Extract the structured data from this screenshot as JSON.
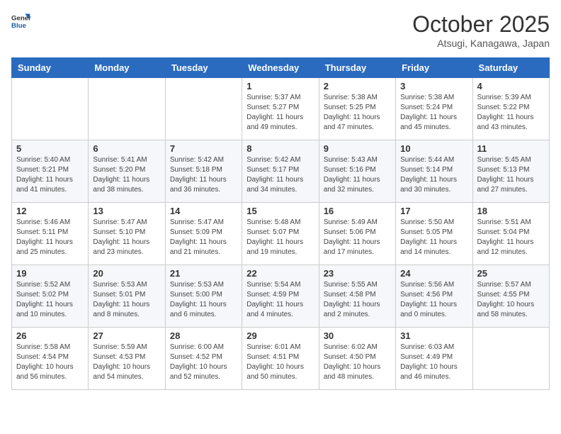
{
  "header": {
    "logo_line1": "General",
    "logo_line2": "Blue",
    "month": "October 2025",
    "location": "Atsugi, Kanagawa, Japan"
  },
  "weekdays": [
    "Sunday",
    "Monday",
    "Tuesday",
    "Wednesday",
    "Thursday",
    "Friday",
    "Saturday"
  ],
  "weeks": [
    [
      {
        "day": "",
        "info": ""
      },
      {
        "day": "",
        "info": ""
      },
      {
        "day": "",
        "info": ""
      },
      {
        "day": "1",
        "info": "Sunrise: 5:37 AM\nSunset: 5:27 PM\nDaylight: 11 hours\nand 49 minutes."
      },
      {
        "day": "2",
        "info": "Sunrise: 5:38 AM\nSunset: 5:25 PM\nDaylight: 11 hours\nand 47 minutes."
      },
      {
        "day": "3",
        "info": "Sunrise: 5:38 AM\nSunset: 5:24 PM\nDaylight: 11 hours\nand 45 minutes."
      },
      {
        "day": "4",
        "info": "Sunrise: 5:39 AM\nSunset: 5:22 PM\nDaylight: 11 hours\nand 43 minutes."
      }
    ],
    [
      {
        "day": "5",
        "info": "Sunrise: 5:40 AM\nSunset: 5:21 PM\nDaylight: 11 hours\nand 41 minutes."
      },
      {
        "day": "6",
        "info": "Sunrise: 5:41 AM\nSunset: 5:20 PM\nDaylight: 11 hours\nand 38 minutes."
      },
      {
        "day": "7",
        "info": "Sunrise: 5:42 AM\nSunset: 5:18 PM\nDaylight: 11 hours\nand 36 minutes."
      },
      {
        "day": "8",
        "info": "Sunrise: 5:42 AM\nSunset: 5:17 PM\nDaylight: 11 hours\nand 34 minutes."
      },
      {
        "day": "9",
        "info": "Sunrise: 5:43 AM\nSunset: 5:16 PM\nDaylight: 11 hours\nand 32 minutes."
      },
      {
        "day": "10",
        "info": "Sunrise: 5:44 AM\nSunset: 5:14 PM\nDaylight: 11 hours\nand 30 minutes."
      },
      {
        "day": "11",
        "info": "Sunrise: 5:45 AM\nSunset: 5:13 PM\nDaylight: 11 hours\nand 27 minutes."
      }
    ],
    [
      {
        "day": "12",
        "info": "Sunrise: 5:46 AM\nSunset: 5:11 PM\nDaylight: 11 hours\nand 25 minutes."
      },
      {
        "day": "13",
        "info": "Sunrise: 5:47 AM\nSunset: 5:10 PM\nDaylight: 11 hours\nand 23 minutes."
      },
      {
        "day": "14",
        "info": "Sunrise: 5:47 AM\nSunset: 5:09 PM\nDaylight: 11 hours\nand 21 minutes."
      },
      {
        "day": "15",
        "info": "Sunrise: 5:48 AM\nSunset: 5:07 PM\nDaylight: 11 hours\nand 19 minutes."
      },
      {
        "day": "16",
        "info": "Sunrise: 5:49 AM\nSunset: 5:06 PM\nDaylight: 11 hours\nand 17 minutes."
      },
      {
        "day": "17",
        "info": "Sunrise: 5:50 AM\nSunset: 5:05 PM\nDaylight: 11 hours\nand 14 minutes."
      },
      {
        "day": "18",
        "info": "Sunrise: 5:51 AM\nSunset: 5:04 PM\nDaylight: 11 hours\nand 12 minutes."
      }
    ],
    [
      {
        "day": "19",
        "info": "Sunrise: 5:52 AM\nSunset: 5:02 PM\nDaylight: 11 hours\nand 10 minutes."
      },
      {
        "day": "20",
        "info": "Sunrise: 5:53 AM\nSunset: 5:01 PM\nDaylight: 11 hours\nand 8 minutes."
      },
      {
        "day": "21",
        "info": "Sunrise: 5:53 AM\nSunset: 5:00 PM\nDaylight: 11 hours\nand 6 minutes."
      },
      {
        "day": "22",
        "info": "Sunrise: 5:54 AM\nSunset: 4:59 PM\nDaylight: 11 hours\nand 4 minutes."
      },
      {
        "day": "23",
        "info": "Sunrise: 5:55 AM\nSunset: 4:58 PM\nDaylight: 11 hours\nand 2 minutes."
      },
      {
        "day": "24",
        "info": "Sunrise: 5:56 AM\nSunset: 4:56 PM\nDaylight: 11 hours\nand 0 minutes."
      },
      {
        "day": "25",
        "info": "Sunrise: 5:57 AM\nSunset: 4:55 PM\nDaylight: 10 hours\nand 58 minutes."
      }
    ],
    [
      {
        "day": "26",
        "info": "Sunrise: 5:58 AM\nSunset: 4:54 PM\nDaylight: 10 hours\nand 56 minutes."
      },
      {
        "day": "27",
        "info": "Sunrise: 5:59 AM\nSunset: 4:53 PM\nDaylight: 10 hours\nand 54 minutes."
      },
      {
        "day": "28",
        "info": "Sunrise: 6:00 AM\nSunset: 4:52 PM\nDaylight: 10 hours\nand 52 minutes."
      },
      {
        "day": "29",
        "info": "Sunrise: 6:01 AM\nSunset: 4:51 PM\nDaylight: 10 hours\nand 50 minutes."
      },
      {
        "day": "30",
        "info": "Sunrise: 6:02 AM\nSunset: 4:50 PM\nDaylight: 10 hours\nand 48 minutes."
      },
      {
        "day": "31",
        "info": "Sunrise: 6:03 AM\nSunset: 4:49 PM\nDaylight: 10 hours\nand 46 minutes."
      },
      {
        "day": "",
        "info": ""
      }
    ]
  ]
}
